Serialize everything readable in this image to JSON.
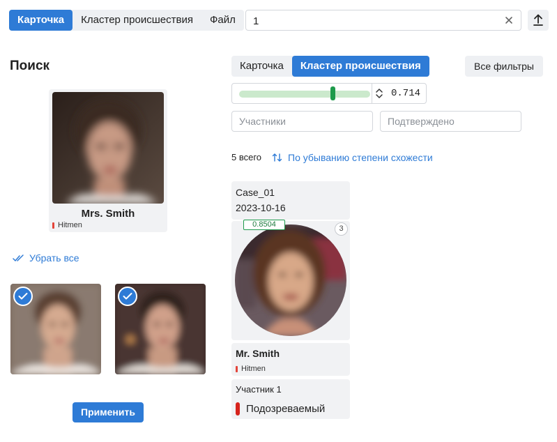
{
  "top_tabs": [
    {
      "label": "Карточка",
      "active": true
    },
    {
      "label": "Кластер происшествия",
      "active": false
    },
    {
      "label": "Файл",
      "active": false
    }
  ],
  "search": {
    "value": "1",
    "clear_icon": "close-icon"
  },
  "upload_icon": "upload-icon",
  "search_panel": {
    "title": "Поиск",
    "query_card": {
      "name": "Mrs. Smith",
      "tag": "Hitmen",
      "tag_color": "#e3443a"
    },
    "remove_all_label": "Убрать все",
    "apply_label": "Применить"
  },
  "result_tabs": [
    {
      "label": "Карточка",
      "active": false
    },
    {
      "label": "Кластер происшествия",
      "active": true
    }
  ],
  "all_filters_label": "Все фильтры",
  "threshold": {
    "value": "0.714",
    "fraction": 0.714
  },
  "filters": {
    "participants_placeholder": "Участники",
    "confirmed_placeholder": "Подтверждено"
  },
  "results_summary": {
    "count_label": "5 всего",
    "sort_label": "По убыванию степени схожести"
  },
  "result_card": {
    "case": "Case_01",
    "date": "2023-10-16",
    "score": "0.8504",
    "photos_count": "3",
    "name": "Mr. Smith",
    "tag": "Hitmen",
    "participant_label": "Участник 1",
    "role": "Подозреваемый",
    "role_color": "#d6231c"
  },
  "colors": {
    "accent": "#2e7bd6",
    "success": "#1e9a4b",
    "panel_bg": "#f1f2f4"
  }
}
